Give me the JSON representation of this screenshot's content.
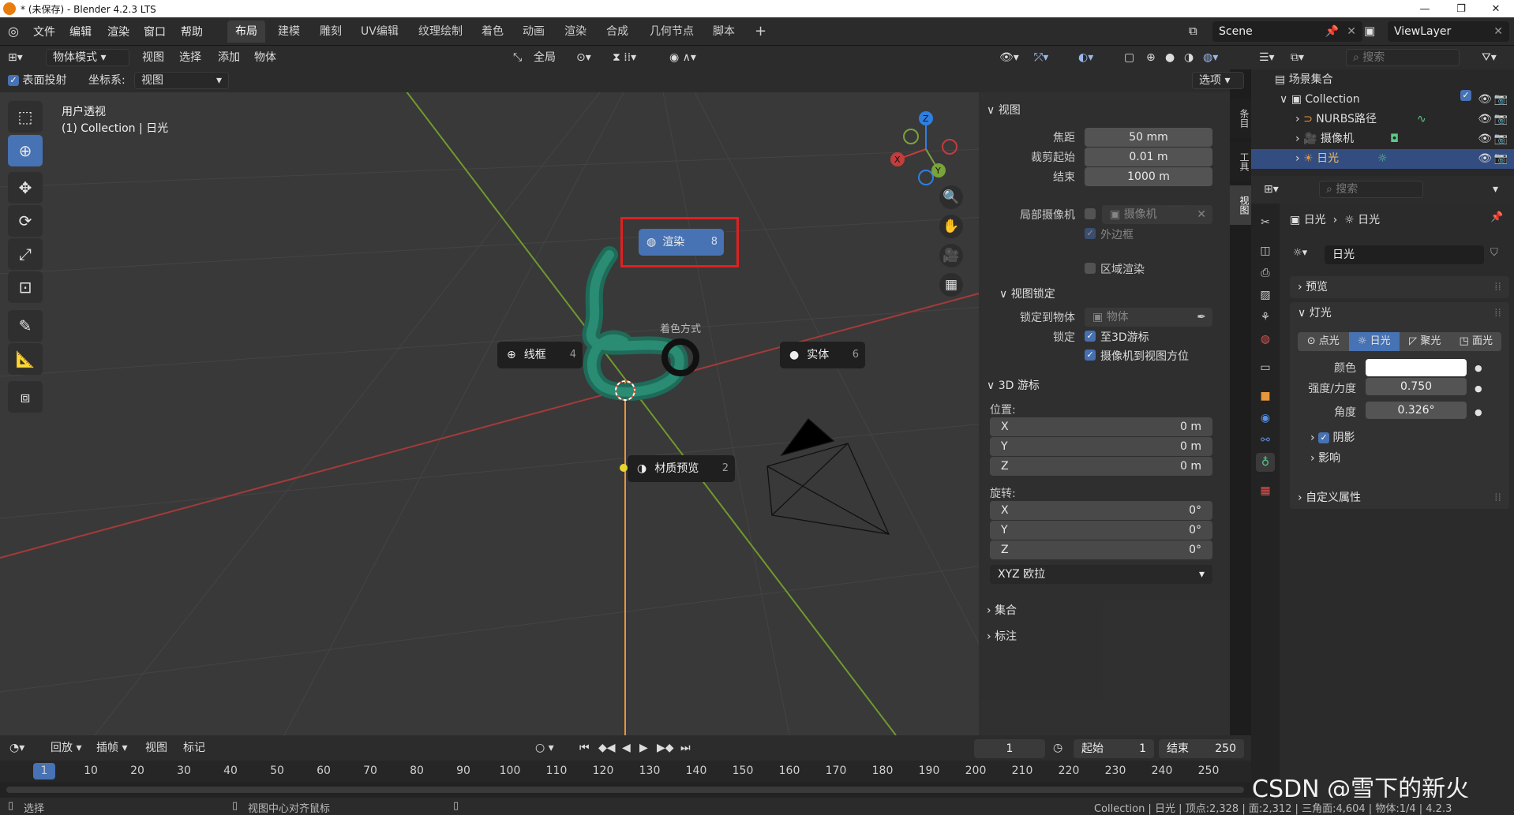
{
  "window": {
    "title": "* (未保存) - Blender 4.2.3 LTS",
    "minimize": "—",
    "restore": "❐",
    "close": "✕"
  },
  "menus": [
    "文件",
    "编辑",
    "渲染",
    "窗口",
    "帮助"
  ],
  "workspaces": [
    "布局",
    "建模",
    "雕刻",
    "UV编辑",
    "纹理绘制",
    "着色",
    "动画",
    "渲染",
    "合成",
    "几何节点",
    "脚本"
  ],
  "workspace_add": "+",
  "scene": "Scene",
  "viewlayer": "ViewLayer",
  "viewport_header": {
    "mode": "物体模式",
    "view": "视图",
    "select": "选择",
    "add": "添加",
    "object": "物体",
    "transform": "全局",
    "options": "选项"
  },
  "viewport_header2": {
    "surface_project": "表面投射",
    "coord_label": "坐标系:",
    "coord_value": "视图"
  },
  "overlay_text": {
    "view_name": "用户透视",
    "collection_info": "(1) Collection | 日光"
  },
  "gizmo": {
    "x": "X",
    "y": "Y",
    "z": "Z"
  },
  "pie": {
    "title": "着色方式",
    "render": {
      "label": "渲染",
      "key": "8"
    },
    "wireframe": {
      "label": "线框",
      "key": "4"
    },
    "solid": {
      "label": "实体",
      "key": "6"
    },
    "material": {
      "label": "材质预览",
      "key": "2"
    }
  },
  "npanel": {
    "view_header": "视图",
    "focal_label": "焦距",
    "focal_value": "50 mm",
    "clip_start_label": "裁剪起始",
    "clip_start_value": "0.01 m",
    "clip_end_label": "结束",
    "clip_end_value": "1000 m",
    "local_cam_label": "局部摄像机",
    "local_cam_value": "摄像机",
    "border_label": "外边框",
    "region_render_label": "区域渲染",
    "view_lock_header": "视图锁定",
    "lock_object_label": "锁定到物体",
    "lock_object_value": "物体",
    "lock_label": "锁定",
    "lock_cursor": "至3D游标",
    "lock_camera": "摄像机到视图方位",
    "cursor_header": "3D 游标",
    "location_label": "位置:",
    "loc": [
      {
        "axis": "X",
        "value": "0 m"
      },
      {
        "axis": "Y",
        "value": "0 m"
      },
      {
        "axis": "Z",
        "value": "0 m"
      }
    ],
    "rotation_label": "旋转:",
    "rot": [
      {
        "axis": "X",
        "value": "0°"
      },
      {
        "axis": "Y",
        "value": "0°"
      },
      {
        "axis": "Z",
        "value": "0°"
      }
    ],
    "rot_mode": "XYZ 欧拉",
    "collection_header": "集合",
    "annotation_header": "标注"
  },
  "side_tabs": [
    "条目",
    "工具",
    "视图"
  ],
  "outliner": {
    "search_placeholder": "搜索",
    "scene_collection": "场景集合",
    "collection": "Collection",
    "items": [
      "NURBS路径",
      "摄像机",
      "日光"
    ]
  },
  "properties": {
    "search_placeholder": "搜索",
    "breadcrumb_obj": "日光",
    "breadcrumb_data": "日光",
    "datablock": "日光",
    "preview": "预览",
    "light_header": "灯光",
    "light_types": [
      "点光",
      "日光",
      "聚光",
      "面光"
    ],
    "color_label": "颜色",
    "strength_label": "强度/力度",
    "strength_value": "0.750",
    "angle_label": "角度",
    "angle_value": "0.326°",
    "shadow": "阴影",
    "influence": "影响",
    "custom_props": "自定义属性"
  },
  "timeline": {
    "playback": "回放",
    "keying": "插帧",
    "view": "视图",
    "marker": "标记",
    "current_frame": "1",
    "start_label": "起始",
    "start_value": "1",
    "end_label": "结束",
    "end_value": "250",
    "ticks": [
      "1",
      "10",
      "20",
      "30",
      "40",
      "50",
      "60",
      "70",
      "80",
      "90",
      "100",
      "110",
      "120",
      "130",
      "140",
      "150",
      "160",
      "170",
      "180",
      "190",
      "200",
      "210",
      "220",
      "230",
      "240",
      "250"
    ]
  },
  "status": {
    "select": "选择",
    "center_view": "视图中心对齐鼠标",
    "info": "Collection | 日光 | 顶点:2,328 | 面:2,312 | 三角面:4,604 | 物体:1/4 | 4.2.3"
  },
  "watermark": "CSDN @雪下的新火",
  "colors": {
    "accent": "#4772b3",
    "highlight_box": "#e02020",
    "x_axis": "#c43c3c",
    "y_axis": "#7aa33a",
    "z_axis": "#e8963a"
  }
}
